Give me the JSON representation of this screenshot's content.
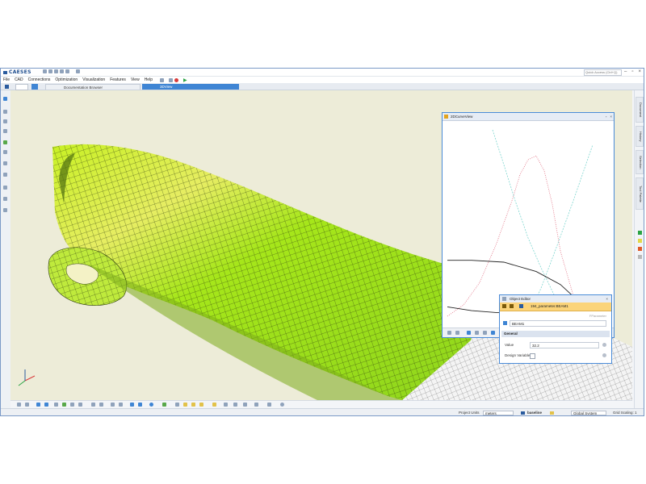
{
  "app": {
    "brand": "CAESES",
    "quick_access_placeholder": "Quick Access (Ctrl+Q)"
  },
  "menu": [
    "File",
    "CAD",
    "Connections",
    "Optimization",
    "Visualization",
    "Features",
    "View",
    "Help"
  ],
  "tabs": [
    {
      "label": "Documentation Browser",
      "active": false
    },
    {
      "label": "3DView",
      "active": true
    }
  ],
  "chart_window": {
    "title": "2DCurveView",
    "chart_data": {
      "type": "line",
      "title": "",
      "xlabel": "",
      "ylabel": "",
      "xlim": [
        0,
        1
      ],
      "ylim": [
        0,
        1
      ],
      "grid": false,
      "legend": "none",
      "series": [
        {
          "color": "#e06b7f",
          "style": "dotted",
          "x": [
            0,
            0.1,
            0.2,
            0.3,
            0.4,
            0.45,
            0.5,
            0.55,
            0.6,
            0.65,
            0.7,
            0.8
          ],
          "y": [
            0.0,
            0.06,
            0.18,
            0.38,
            0.62,
            0.76,
            0.84,
            0.86,
            0.78,
            0.6,
            0.35,
            0.05
          ]
        },
        {
          "color": "#7fd6d0",
          "style": "dashed",
          "x": [
            0.28,
            0.34,
            0.42,
            0.5,
            0.58,
            0.68,
            0.73
          ],
          "y": [
            1.0,
            0.84,
            0.62,
            0.42,
            0.26,
            0.08,
            0.0
          ]
        },
        {
          "color": "#7fd6d0",
          "style": "dashed",
          "x": [
            0.5,
            0.58,
            0.68,
            0.78,
            0.86,
            0.9
          ],
          "y": [
            0.0,
            0.15,
            0.38,
            0.62,
            0.82,
            0.92
          ]
        },
        {
          "color": "#222222",
          "style": "solid",
          "x": [
            0,
            0.15,
            0.35,
            0.55,
            0.7,
            0.8,
            0.86
          ],
          "y": [
            0.3,
            0.3,
            0.29,
            0.24,
            0.17,
            0.09,
            0.0
          ]
        },
        {
          "color": "#222222",
          "style": "solid",
          "x": [
            0,
            0.15,
            0.3,
            0.5,
            0.65,
            0.72
          ],
          "y": [
            0.05,
            0.03,
            0.02,
            0.02,
            0.02,
            0.0
          ]
        },
        {
          "color": "#6cc86c",
          "style": "solid",
          "x": [
            0.45,
            0.8
          ],
          "y": [
            0.0,
            0.0
          ]
        }
      ]
    }
  },
  "object_editor": {
    "title": "Object Editor",
    "object_path": "194_parameter.BEAM1",
    "type_hint": "FParameter",
    "name_value": "BEAM1",
    "section": "General",
    "value_label": "Value",
    "value": "32.2",
    "design_variable_label": "Design Variable",
    "design_variable_checked": false
  },
  "right_panel_tabs": [
    "Document",
    "History",
    "Selection",
    "Tool Palette"
  ],
  "status": {
    "project_units_label": "Project Units",
    "project_units_value": "meters",
    "baseline_label": "baseline",
    "coord_system": "Global System",
    "grid_scaling_label": "Grid Scaling: 1"
  },
  "colors": {
    "accent": "#3f85d4",
    "hull_green": "#a6e61a",
    "hull_yellow": "#e6ed62",
    "editor_highlight": "#fbd47a",
    "background": "#edecd8"
  }
}
